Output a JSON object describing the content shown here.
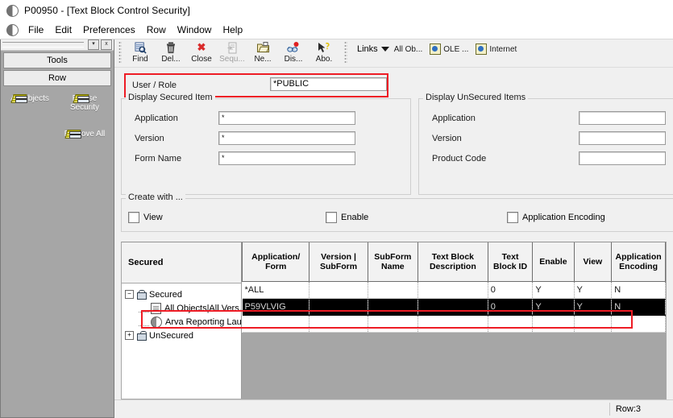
{
  "window": {
    "title": "P00950 - [Text Block Control Security]",
    "app_icon": "half-circle-icon"
  },
  "menubar": {
    "items": [
      {
        "label": "File"
      },
      {
        "label": "Edit"
      },
      {
        "label": "Preferences"
      },
      {
        "label": "Row"
      },
      {
        "label": "Window"
      },
      {
        "label": "Help"
      }
    ]
  },
  "sidebar": {
    "header_buttons": [
      {
        "label": "Tools"
      },
      {
        "label": "Row"
      }
    ],
    "mini_buttons": [
      {
        "label": "▾",
        "name": "panel-dropdown-button"
      },
      {
        "label": "x",
        "name": "panel-close-button"
      }
    ],
    "icons": [
      {
        "label": "All Objects",
        "icon": "objects-icon",
        "blurred": false
      },
      {
        "label": "Revise Security",
        "icon": "objects-icon",
        "blurred": false
      },
      {
        "label": "",
        "icon": "blurred-icon",
        "blurred": true
      },
      {
        "label": "Remove All",
        "icon": "objects-icon",
        "blurred": false
      },
      {
        "label": "",
        "icon": "blurred-icon",
        "blurred": true
      },
      {
        "label": "",
        "icon": "blurred-icon",
        "blurred": true
      }
    ]
  },
  "toolbar": {
    "buttons": [
      {
        "label": "Find",
        "icon": "find-icon",
        "disabled": false
      },
      {
        "label": "Del...",
        "icon": "trash-icon",
        "disabled": false
      },
      {
        "label": "Close",
        "icon": "close-x-icon",
        "disabled": false
      },
      {
        "label": "Sequ...",
        "icon": "sequence-icon",
        "disabled": true
      },
      {
        "label": "Ne...",
        "icon": "new-folder-icon",
        "disabled": false
      },
      {
        "label": "Dis...",
        "icon": "display-icon",
        "disabled": false
      },
      {
        "label": "Abo.",
        "icon": "about-help-icon",
        "disabled": false
      }
    ],
    "links_label": "Links",
    "links_items": [
      {
        "label": "All Ob...",
        "icon": "none"
      },
      {
        "label": "OLE ...",
        "icon": "ole-icon"
      },
      {
        "label": "Internet",
        "icon": "ole-icon"
      }
    ]
  },
  "form": {
    "user_role": {
      "label": "User / Role",
      "value": "*PUBLIC",
      "placeholder": ""
    },
    "display_secured": {
      "legend": "Display Secured Item",
      "fields": [
        {
          "label": "Application",
          "value": "*"
        },
        {
          "label": "Version",
          "value": "*"
        },
        {
          "label": "Form Name",
          "value": "*"
        }
      ]
    },
    "display_unsecured": {
      "legend": "Display UnSecured Items",
      "fields": [
        {
          "label": "Application",
          "value": ""
        },
        {
          "label": "Version",
          "value": ""
        },
        {
          "label": "Product Code",
          "value": ""
        }
      ]
    },
    "create_with": {
      "legend": "Create with ...",
      "checkboxes": [
        {
          "label": "View",
          "checked": false
        },
        {
          "label": "Enable",
          "checked": false
        },
        {
          "label": "Application Encoding",
          "checked": false
        }
      ]
    }
  },
  "tree": {
    "header": "Secured",
    "nodes": [
      {
        "label": "Secured",
        "icon": "lock-closed-icon",
        "expander": "−",
        "level": 1
      },
      {
        "label": "All Objects|All Vers.",
        "icon": "document-icon",
        "expander": "",
        "level": 2
      },
      {
        "label": "Arva Reporting Lau|All",
        "icon": "half-circle-icon",
        "expander": "",
        "level": 2
      },
      {
        "label": "UnSecured",
        "icon": "lock-open-icon",
        "expander": "+",
        "level": 1
      }
    ]
  },
  "grid": {
    "columns": [
      "Application/ Form",
      "Version | SubForm",
      "SubForm Name",
      "Text Block Description",
      "Text Block ID",
      "Enable",
      "View",
      "Application Encoding"
    ],
    "rows": [
      {
        "selected": false,
        "cells": [
          "*ALL",
          "",
          "",
          "",
          "0",
          "Y",
          "Y",
          "N"
        ]
      },
      {
        "selected": true,
        "cells": [
          "P59VLVIG",
          "",
          "",
          "",
          "0",
          "Y",
          "Y",
          "N"
        ]
      },
      {
        "selected": false,
        "cells": [
          "",
          "",
          "",
          "",
          "",
          "",
          "",
          ""
        ]
      }
    ]
  },
  "statusbar": {
    "row_label": "Row:3"
  },
  "highlights": {
    "color": "#ee1c25",
    "boxes": [
      {
        "name": "user-role-highlight"
      },
      {
        "name": "selected-row-highlight"
      },
      {
        "name": "tree-selected-node-highlight"
      }
    ]
  }
}
